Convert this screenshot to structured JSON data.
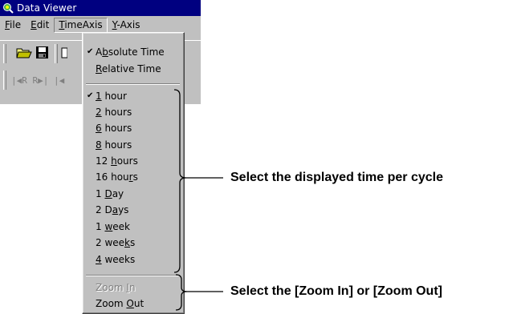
{
  "window": {
    "title": "Data Viewer"
  },
  "menubar": {
    "items": [
      {
        "pre": "",
        "ul": "F",
        "post": "ile"
      },
      {
        "pre": "",
        "ul": "E",
        "post": "dit"
      },
      {
        "pre": "",
        "ul": "T",
        "post": "imeAxis"
      },
      {
        "pre": "",
        "ul": "Y",
        "post": "-Axis"
      }
    ]
  },
  "toolbar2": {
    "text": "|◀R R▶| |◀"
  },
  "timeaxis_menu": {
    "mode_items": [
      {
        "checked": true,
        "pre": "A",
        "ul": "b",
        "post": "solute Time"
      },
      {
        "checked": false,
        "pre": "",
        "ul": "R",
        "post": "elative Time"
      }
    ],
    "cycle_items": [
      {
        "checked": true,
        "pre": "",
        "ul": "1",
        "post": " hour"
      },
      {
        "checked": false,
        "pre": "",
        "ul": "2",
        "post": " hours"
      },
      {
        "checked": false,
        "pre": "",
        "ul": "6",
        "post": " hours"
      },
      {
        "checked": false,
        "pre": "",
        "ul": "8",
        "post": " hours"
      },
      {
        "checked": false,
        "pre": "12 ",
        "ul": "h",
        "post": "ours"
      },
      {
        "checked": false,
        "pre": "16 hou",
        "ul": "r",
        "post": "s"
      },
      {
        "checked": false,
        "pre": "1 ",
        "ul": "D",
        "post": "ay"
      },
      {
        "checked": false,
        "pre": "2 D",
        "ul": "a",
        "post": "ys"
      },
      {
        "checked": false,
        "pre": "1 ",
        "ul": "w",
        "post": "eek"
      },
      {
        "checked": false,
        "pre": "2 wee",
        "ul": "k",
        "post": "s"
      },
      {
        "checked": false,
        "pre": "",
        "ul": "4",
        "post": " weeks"
      }
    ],
    "zoom_items": [
      {
        "disabled": true,
        "pre": "Zoom ",
        "ul": "I",
        "post": "n"
      },
      {
        "disabled": false,
        "pre": "Zoom ",
        "ul": "O",
        "post": "ut"
      }
    ]
  },
  "callouts": {
    "cycle": "Select the displayed time per cycle",
    "zoom": "Select the [Zoom In] or [Zoom Out]"
  }
}
